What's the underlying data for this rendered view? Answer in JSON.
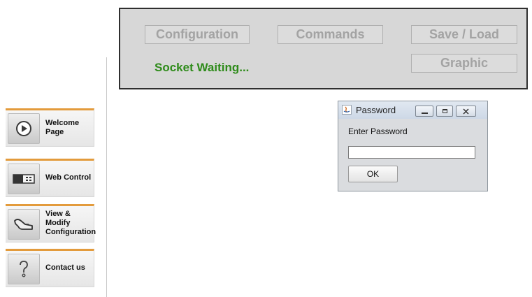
{
  "applet": {
    "buttons": {
      "configuration": "Configuration",
      "commands": "Commands",
      "save_load": "Save / Load",
      "graphic": "Graphic"
    },
    "status": "Socket Waiting..."
  },
  "nav": {
    "items": [
      {
        "label": "Welcome Page",
        "icon": "play-icon"
      },
      {
        "label": "Web Control",
        "icon": "device-icon"
      },
      {
        "label": "View & Modify Configuration",
        "icon": "hand-pointer-icon"
      },
      {
        "label": "Contact us",
        "icon": "question-icon"
      }
    ]
  },
  "dialog": {
    "title": "Password",
    "prompt": "Enter Password",
    "password_value": "",
    "ok_label": "OK"
  },
  "colors": {
    "panel_bg": "#d7d7d7",
    "status_green": "#2e8b1a",
    "nav_accent": "#e39b3c",
    "disabled_text": "#a3a3a3"
  }
}
